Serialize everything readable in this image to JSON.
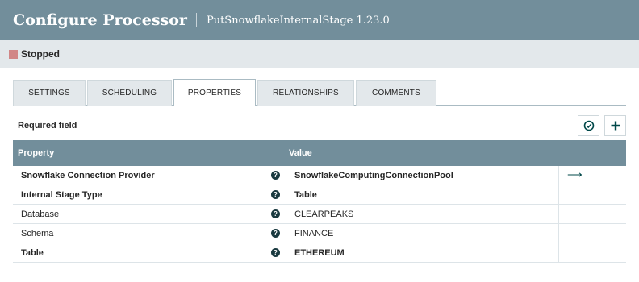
{
  "header": {
    "title": "Configure Processor",
    "subtitle": "PutSnowflakeInternalStage 1.23.0"
  },
  "status": {
    "text": "Stopped",
    "color": "#d18686"
  },
  "tabs": [
    {
      "label": "SETTINGS",
      "active": false
    },
    {
      "label": "SCHEDULING",
      "active": false
    },
    {
      "label": "PROPERTIES",
      "active": true
    },
    {
      "label": "RELATIONSHIPS",
      "active": false
    },
    {
      "label": "COMMENTS",
      "active": false
    }
  ],
  "properties": {
    "required_label": "Required field",
    "columns": {
      "property": "Property",
      "value": "Value"
    },
    "rows": [
      {
        "name": "Snowflake Connection Provider",
        "value": "SnowflakeComputingConnectionPool",
        "required": true,
        "has_goto": true
      },
      {
        "name": "Internal Stage Type",
        "value": "Table",
        "required": true,
        "has_goto": false
      },
      {
        "name": "Database",
        "value": "CLEARPEAKS",
        "required": false,
        "has_goto": false
      },
      {
        "name": "Schema",
        "value": "FINANCE",
        "required": false,
        "has_goto": false
      },
      {
        "name": "Table",
        "value": "ETHEREUM",
        "required": true,
        "has_goto": false
      }
    ]
  },
  "icons": {
    "help": "question-circle-icon",
    "goto": "arrow-right-icon",
    "verify": "check-circle-icon",
    "add": "plus-icon"
  },
  "colors": {
    "header_bg": "#728e9b",
    "accent": "#004849"
  }
}
